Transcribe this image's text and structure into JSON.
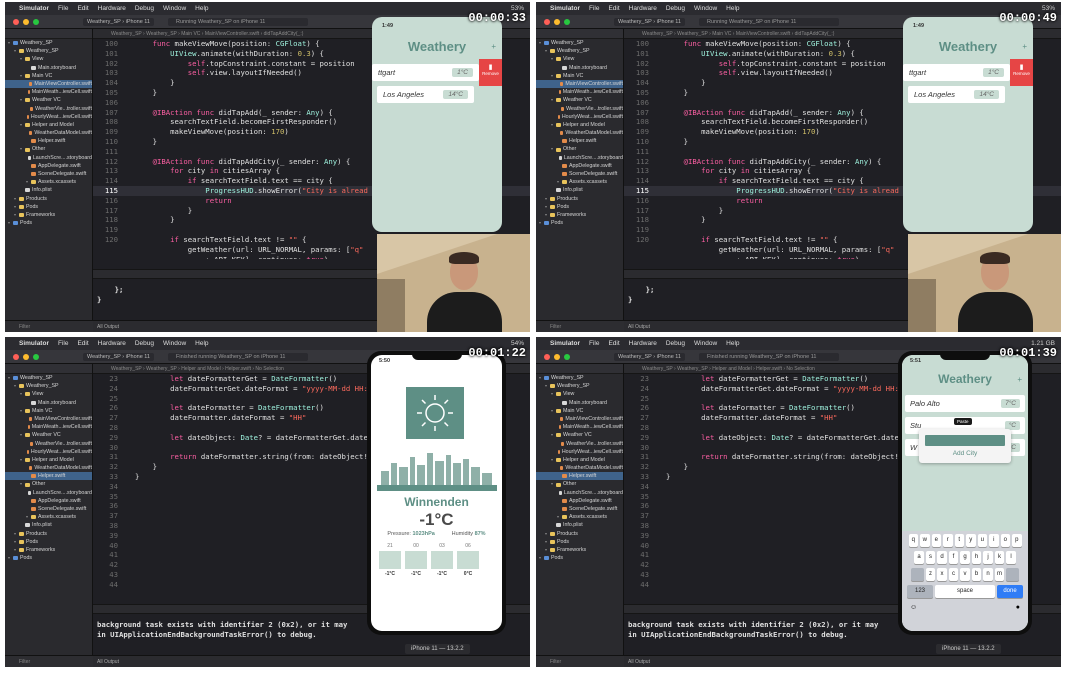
{
  "menubar": {
    "app_name": "Simulator",
    "items": [
      "File",
      "Edit",
      "Hardware",
      "Debug",
      "Window",
      "Help"
    ],
    "battery": [
      "53%",
      "53%",
      "54%",
      "1.21 GB"
    ]
  },
  "scheme": {
    "project": "Weathery_SP",
    "device": "iPhone 11",
    "status_running": "Running Weathery_SP on iPhone 11",
    "status_finished": "Finished running Weathery_SP on iPhone 11"
  },
  "jumpbar": {
    "top": "Weathery_SP  ›  Weathery_SP  ›  Main VC  ›  MainViewController.swift  ›  didTapAddCity(_:)",
    "bottom": "Weathery_SP  ›  Weathery_SP  ›  Helper and Model  ›  Helper.swift  ›  No Selection"
  },
  "timestamps": [
    "00:00:33",
    "00:00:49",
    "00:01:22",
    "00:01:39"
  ],
  "navigator": {
    "filter_placeholder": "Filter",
    "items": [
      {
        "label": "Weathery_SP",
        "level": 0,
        "type": "proj"
      },
      {
        "label": "Weathery_SP",
        "level": 1,
        "type": "folder"
      },
      {
        "label": "View",
        "level": 2,
        "type": "folder"
      },
      {
        "label": "Main.storyboard",
        "level": 3,
        "type": "sb"
      },
      {
        "label": "Main VC",
        "level": 2,
        "type": "folder"
      },
      {
        "label": "MainViewController.swift",
        "level": 3,
        "type": "file"
      },
      {
        "label": "MainWeath...iewCell.swift",
        "level": 3,
        "type": "file"
      },
      {
        "label": "Weather VC",
        "level": 2,
        "type": "folder"
      },
      {
        "label": "WeatherVie...troller.swift",
        "level": 3,
        "type": "file"
      },
      {
        "label": "HourlyWeat...iewCell.swift",
        "level": 3,
        "type": "file"
      },
      {
        "label": "Helper and Model",
        "level": 2,
        "type": "folder"
      },
      {
        "label": "WeatherDataModel.swift",
        "level": 3,
        "type": "file"
      },
      {
        "label": "Helper.swift",
        "level": 3,
        "type": "file"
      },
      {
        "label": "Other",
        "level": 2,
        "type": "folder"
      },
      {
        "label": "LaunchScre....storyboard",
        "level": 3,
        "type": "sb"
      },
      {
        "label": "AppDelegate.swift",
        "level": 3,
        "type": "file"
      },
      {
        "label": "SceneDelegate.swift",
        "level": 3,
        "type": "file"
      },
      {
        "label": "Assets.xcassets",
        "level": 3,
        "type": "folder"
      },
      {
        "label": "Info.plist",
        "level": 2,
        "type": "sb"
      },
      {
        "label": "Products",
        "level": 1,
        "type": "folder"
      },
      {
        "label": "Pods",
        "level": 1,
        "type": "folder"
      },
      {
        "label": "Frameworks",
        "level": 1,
        "type": "folder"
      },
      {
        "label": "Pods",
        "level": 0,
        "type": "proj"
      }
    ]
  },
  "code_top": {
    "highlight_line": 115,
    "lines": [
      {
        "n": "100",
        "t": "    func makeViewMove(position: CGFloat) {"
      },
      {
        "n": "101",
        "t": "        UIView.animate(withDuration: 0.3) {"
      },
      {
        "n": "102",
        "t": "            self.topConstraint.constant = position"
      },
      {
        "n": "103",
        "t": "            self.view.layoutIfNeeded()"
      },
      {
        "n": "104",
        "t": "        }"
      },
      {
        "n": "105",
        "t": "    }"
      },
      {
        "n": "106",
        "t": ""
      },
      {
        "n": "107",
        "t": "    @IBAction func didTapAdd(_ sender: Any) {"
      },
      {
        "n": "108",
        "t": "        searchTextField.becomeFirstResponder()"
      },
      {
        "n": "109",
        "t": "        makeViewMove(position: 170)"
      },
      {
        "n": "110",
        "t": "    }"
      },
      {
        "n": "111",
        "t": ""
      },
      {
        "n": "112",
        "t": "    @IBAction func didTapAddCity(_ sender: Any) {"
      },
      {
        "n": "113",
        "t": "        for city in citiesArray {"
      },
      {
        "n": "114",
        "t": "            if searchTextField.text == city {"
      },
      {
        "n": "115",
        "t": "                ProgressHUD.showError(\"City is alread"
      },
      {
        "n": "116",
        "t": "                return"
      },
      {
        "n": "117",
        "t": "            }"
      },
      {
        "n": "118",
        "t": "        }"
      },
      {
        "n": "119",
        "t": ""
      },
      {
        "n": "120",
        "t": "        if searchTextField.text != \"\" {"
      },
      {
        "n": "",
        "t": "            getWeather(url: URL_NORMAL, params: [\"q\""
      },
      {
        "n": "",
        "t": "                : API_KEY], continues: true)"
      },
      {
        "n": "121",
        "t": "        } else {"
      }
    ],
    "console": "    };\n}",
    "bottom_label": "All Output"
  },
  "code_bottom": {
    "lines": [
      {
        "n": "23",
        "t": "        let dateFormatterGet = DateFormatter()"
      },
      {
        "n": "24",
        "t": "        dateFormatterGet.dateFormat = \"yyyy-MM-dd HH:mm:"
      },
      {
        "n": "25",
        "t": ""
      },
      {
        "n": "26",
        "t": "        let dateFormatter = DateFormatter()"
      },
      {
        "n": "27",
        "t": "        dateFormatter.dateFormat = \"HH\""
      },
      {
        "n": "28",
        "t": ""
      },
      {
        "n": "29",
        "t": "        let dateObject: Date? = dateFormatterGet.date(fr"
      },
      {
        "n": "30",
        "t": ""
      },
      {
        "n": "31",
        "t": "        return dateFormatter.string(from: dateObject!)"
      },
      {
        "n": "32",
        "t": "    }"
      },
      {
        "n": "33",
        "t": "}"
      },
      {
        "n": "34",
        "t": ""
      },
      {
        "n": "35",
        "t": ""
      },
      {
        "n": "36",
        "t": ""
      },
      {
        "n": "37",
        "t": ""
      },
      {
        "n": "38",
        "t": ""
      },
      {
        "n": "39",
        "t": ""
      },
      {
        "n": "40",
        "t": ""
      },
      {
        "n": "41",
        "t": ""
      },
      {
        "n": "42",
        "t": ""
      },
      {
        "n": "43",
        "t": ""
      },
      {
        "n": "44",
        "t": ""
      }
    ],
    "console": "background task exists with identifier 2 (0x2), or it may\nin UIApplicationEndBackgroundTaskError() to debug.",
    "bottom_label": "All Output"
  },
  "app_list": {
    "time_1": "1:49",
    "title": "Weathery",
    "plus": "+",
    "remove_label": "Remove",
    "rows": [
      {
        "city": "ttgart",
        "temp": "1°C"
      },
      {
        "city": "Los Angeles",
        "temp": "14°C"
      }
    ]
  },
  "app_detail": {
    "time": "5:50",
    "city": "Winnenden",
    "temp": "-1°C",
    "pressure_label": "Pressure:",
    "pressure_value": "1023hPa",
    "humidity_label": "Humidity",
    "humidity_value": "87%",
    "hours": [
      {
        "h": "21",
        "t": "-1°C"
      },
      {
        "h": "00",
        "t": "-1°C"
      },
      {
        "h": "03",
        "t": "-1°C"
      },
      {
        "h": "06",
        "t": "0°C"
      }
    ]
  },
  "app_add": {
    "time": "5:51",
    "title": "Weathery",
    "plus": "+",
    "rows": [
      {
        "city": "Palo Alto",
        "temp": "7°C"
      },
      {
        "city": "Stu",
        "temp": "°C"
      },
      {
        "city": "W",
        "temp": "°C"
      }
    ],
    "paste_label": "Paste",
    "add_city_label": "Add City",
    "keyboard": {
      "row1": [
        "q",
        "w",
        "e",
        "r",
        "t",
        "y",
        "u",
        "i",
        "o",
        "p"
      ],
      "row2": [
        "a",
        "s",
        "d",
        "f",
        "g",
        "h",
        "j",
        "k",
        "l"
      ],
      "row3": [
        "z",
        "x",
        "c",
        "v",
        "b",
        "n",
        "m"
      ],
      "num": "123",
      "space": "space",
      "done": "done"
    }
  },
  "sim_label": "iPhone 11 — 13.2.2"
}
